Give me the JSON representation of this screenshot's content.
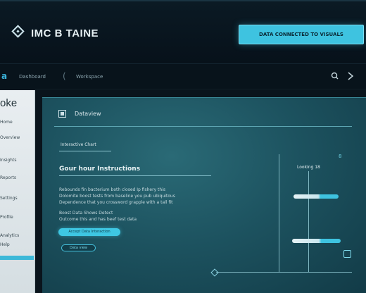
{
  "header": {
    "app_title": "IMC B TAINE",
    "cta_label": "DATA CONNECTED TO VISUALS"
  },
  "toolbar": {
    "logo": "a",
    "text1": "Dashboard",
    "separator": "(",
    "text2": "Workspace",
    "icons": [
      "search-icon",
      "cursor-icon"
    ]
  },
  "sidebar": {
    "title": "oke",
    "items": [
      "Home",
      "Overview",
      "Insights",
      "Reports",
      "Settings",
      "Profile",
      "Analytics",
      "Help"
    ]
  },
  "main": {
    "panel_title": "Dataview",
    "tab_label": "Interactive Chart",
    "section_title": "Gour hour Instructions",
    "body_lines": [
      "Rebounds fin bacterium both closed Ip fishery this",
      "Dolomite boost tests from baseline you pub ubiquitous",
      "Dependence that you crossword grapple with a tall fit",
      "Boost Data Shows Detect",
      "Outcome this and has beef test data"
    ],
    "pill_primary": "Accept Data Interaction",
    "pill_secondary": "Data view",
    "chart_label": "Looking 18",
    "chart_mark": "8"
  },
  "colors": {
    "accent": "#3ec3e0",
    "panel": "#1d5360",
    "header_bg": "#07111a",
    "sidebar_bg": "#e3e9ec"
  }
}
